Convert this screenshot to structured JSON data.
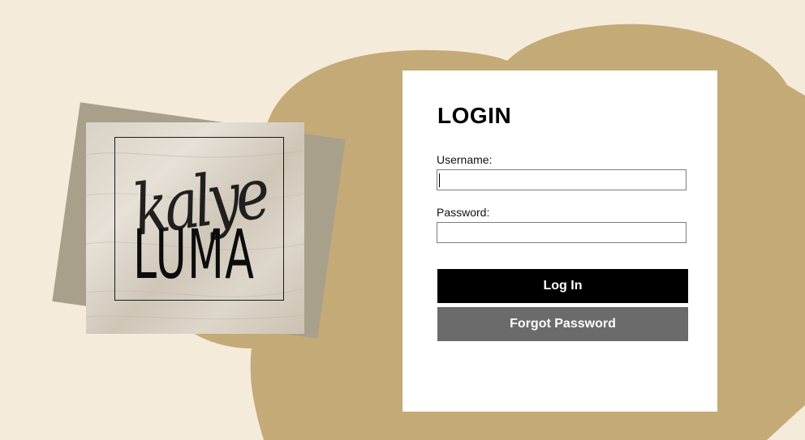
{
  "colors": {
    "page_background": "#f5ebdb",
    "blob": "#c4aa76",
    "logo_back": "#a8a08b",
    "card_background": "#ffffff",
    "login_button": "#000000",
    "forgot_button": "#6b6b6b"
  },
  "logo": {
    "script_text": "kalye",
    "word_text": "LUMA"
  },
  "login": {
    "title": "LOGIN",
    "username_label": "Username:",
    "username_value": "",
    "password_label": "Password:",
    "password_value": "",
    "login_button_label": "Log In",
    "forgot_button_label": "Forgot Password"
  }
}
